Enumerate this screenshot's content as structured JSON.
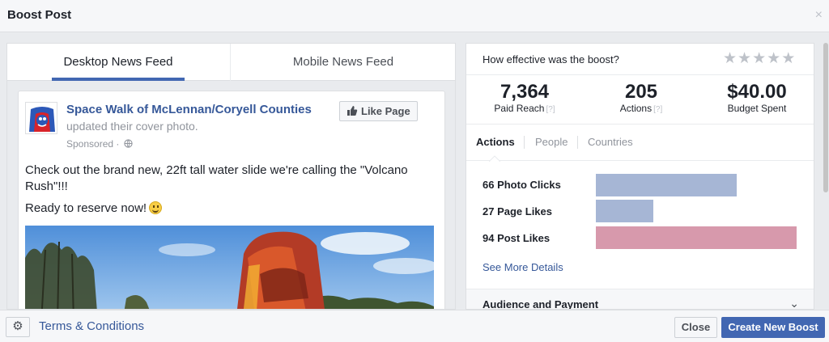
{
  "dialog": {
    "title": "Boost Post",
    "close_glyph": "×"
  },
  "tabs": [
    {
      "label": "Desktop News Feed",
      "active": true
    },
    {
      "label": "Mobile News Feed",
      "active": false
    }
  ],
  "post": {
    "page_name": "Space Walk of McLennan/Coryell Counties",
    "action": "updated their cover photo.",
    "sponsored": "Sponsored ·",
    "like_button": "Like Page",
    "text_line1": "Check out the brand new, 22ft tall water slide we're calling the \"Volcano Rush\"!!!",
    "text_line2": "Ready to reserve now!"
  },
  "insights": {
    "question": "How effective was the boost?",
    "stars_glyph": "★",
    "rating_filled": 0,
    "rating_max": 5,
    "stats": [
      {
        "value": "7,364",
        "label": "Paid Reach",
        "help": "[?]"
      },
      {
        "value": "205",
        "label": "Actions",
        "help": "[?]"
      },
      {
        "value": "$40.00",
        "label": "Budget Spent"
      }
    ],
    "subtabs": [
      {
        "label": "Actions",
        "active": true
      },
      {
        "label": "People",
        "active": false
      },
      {
        "label": "Countries",
        "active": false
      }
    ],
    "metrics": [
      {
        "label": "66 Photo Clicks",
        "value": 66,
        "color": "#a6b6d5"
      },
      {
        "label": "27 Page Likes",
        "value": 27,
        "color": "#a6b6d5"
      },
      {
        "label": "94 Post Likes",
        "value": 94,
        "color": "#d799ac"
      }
    ],
    "see_more": "See More Details",
    "section": "Audience and Payment",
    "section_glyph": "⌄"
  },
  "footer": {
    "gear_glyph": "⚙",
    "terms": "Terms & Conditions",
    "close": "Close",
    "create": "Create New Boost"
  }
}
